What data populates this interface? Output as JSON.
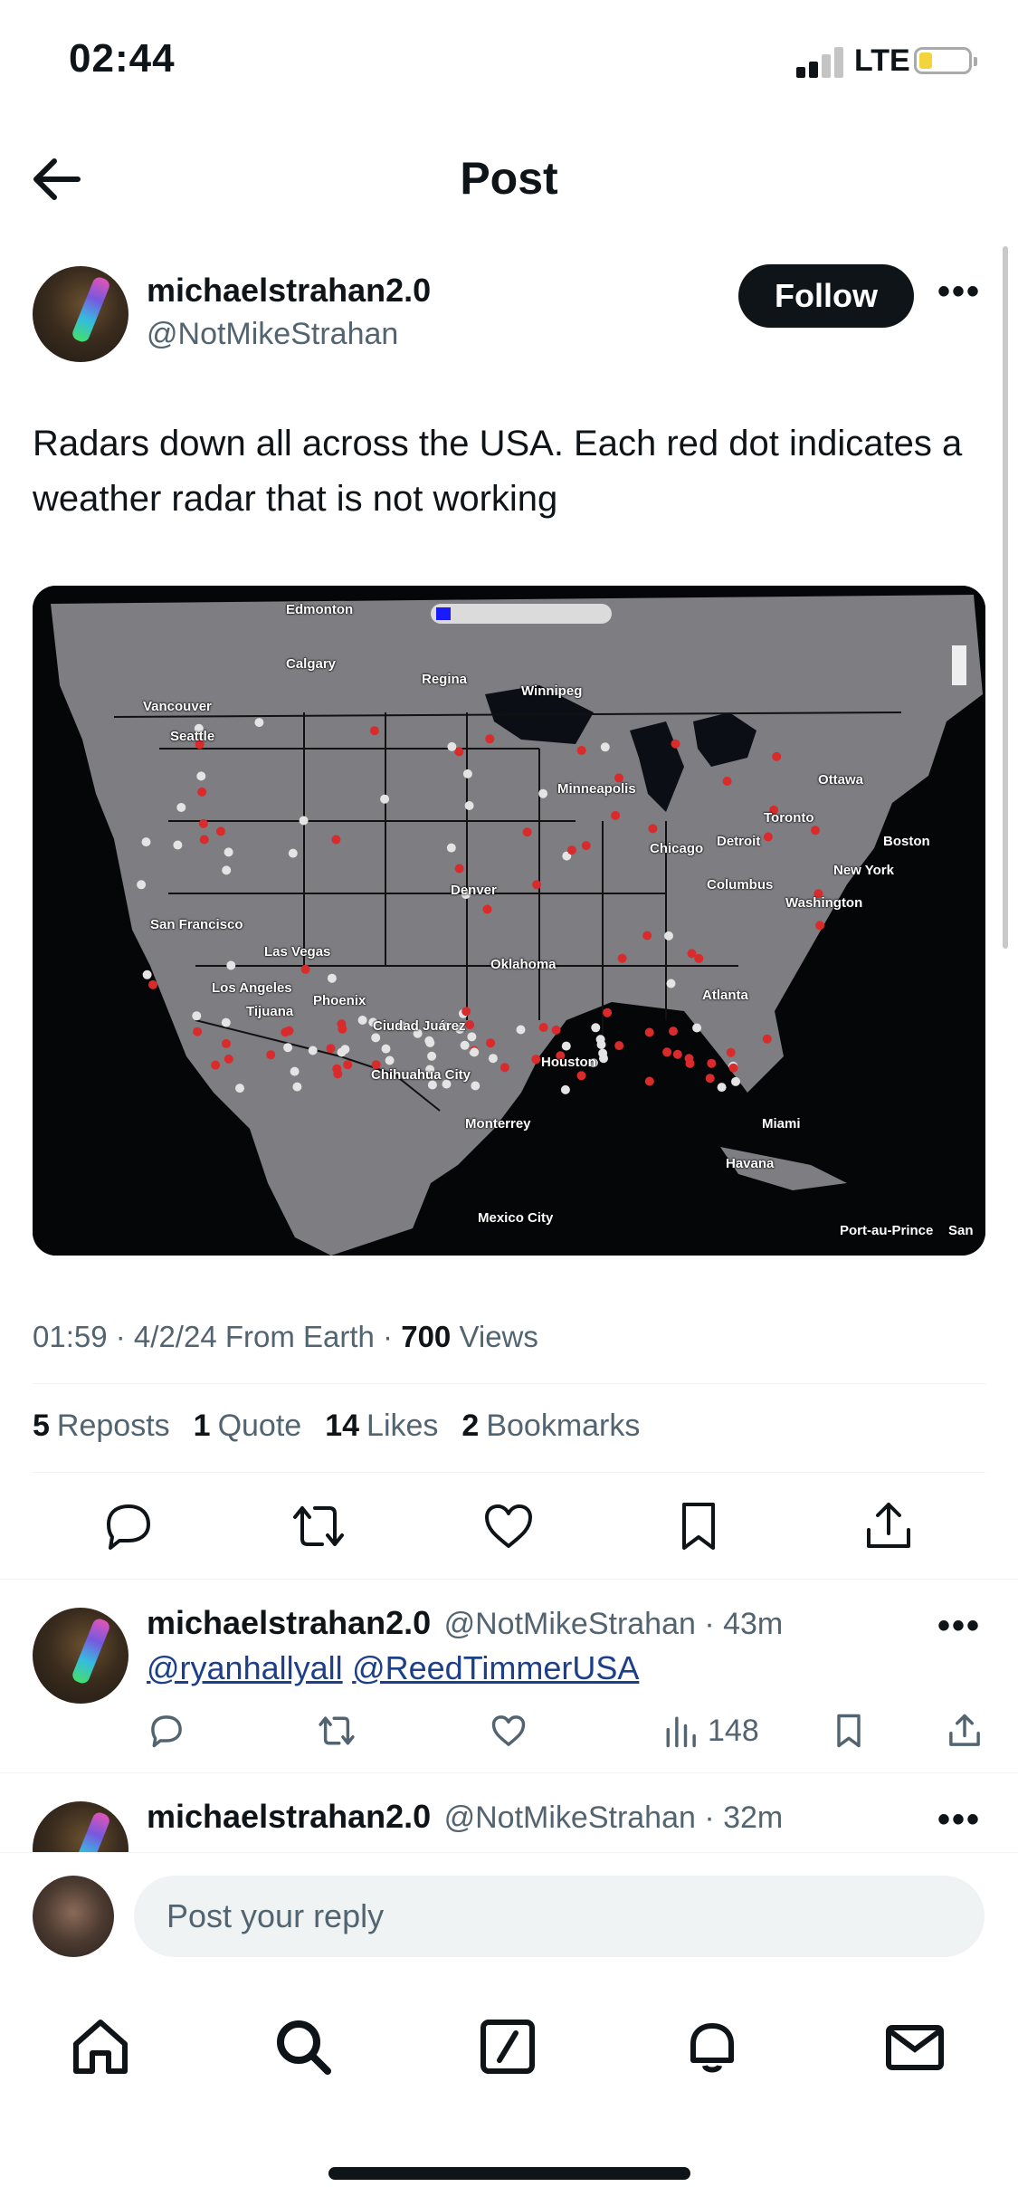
{
  "status_bar": {
    "time": "02:44",
    "network": "LTE"
  },
  "header": {
    "title": "Post"
  },
  "post": {
    "author_name": "michaelstrahan2.0",
    "author_handle": "@NotMikeStrahan",
    "follow_label": "Follow",
    "text": "Radars down all across the USA.  Each red dot indicates a weather radar that is not working",
    "map_labels": [
      "Edmonton",
      "Calgary",
      "Regina",
      "Winnipeg",
      "Vancouver",
      "Seattle",
      "Minneapolis",
      "Ottawa",
      "Toronto",
      "Detroit",
      "Chicago",
      "Boston",
      "New York",
      "Columbus",
      "Washington",
      "Denver",
      "San Francisco",
      "Las Vegas",
      "Oklahoma",
      "Los Angeles",
      "Phoenix",
      "Tijuana",
      "Ciudad Juárez",
      "Atlanta",
      "Houston",
      "Chihuahua City",
      "Miami",
      "Monterrey",
      "Havana",
      "Mexico City",
      "Port-au-Prince",
      "San"
    ],
    "time": "01:59",
    "date": "4/2/24",
    "source": "From Earth",
    "views_count": "700",
    "views_label": "Views",
    "stats": [
      {
        "num": "5",
        "label": "Reposts"
      },
      {
        "num": "1",
        "label": "Quote"
      },
      {
        "num": "14",
        "label": "Likes"
      },
      {
        "num": "2",
        "label": "Bookmarks"
      }
    ]
  },
  "replies": [
    {
      "name": "michaelstrahan2.0",
      "meta": "@NotMikeStrahan · 43m",
      "mentions": [
        "@ryanhallyall",
        "@ReedTimmerUSA"
      ],
      "views": "148"
    },
    {
      "name": "michaelstrahan2.0",
      "meta": "@NotMikeStrahan · 32m"
    }
  ],
  "compose": {
    "placeholder": "Post your reply"
  },
  "colors": {
    "accent": "#0f1419",
    "secondary_text": "#536471",
    "mention": "#1d3f8a",
    "radar_down": "#d92b2b"
  }
}
